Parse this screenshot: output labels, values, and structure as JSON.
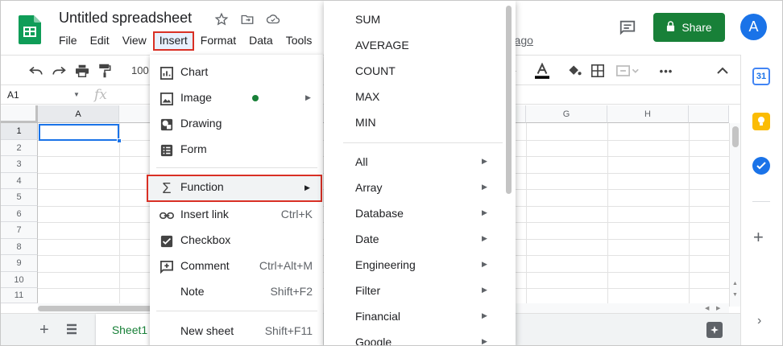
{
  "app": {
    "doc_title": "Untitled spreadsheet",
    "last_edit": "rs ago",
    "share_label": "Share",
    "avatar_initial": "A",
    "accent_green": "#188038"
  },
  "menubar": {
    "items": [
      "File",
      "Edit",
      "View",
      "Insert",
      "Format",
      "Data",
      "Tools",
      "A"
    ],
    "active": "Insert"
  },
  "toolbar": {
    "zoom": "100",
    "icons": [
      "undo-icon",
      "redo-icon",
      "print-icon",
      "paint-format-icon",
      "strikethrough-icon",
      "text-color-icon",
      "fill-color-icon",
      "borders-icon",
      "merge-cells-icon",
      "more-icon",
      "collapse-icon"
    ]
  },
  "formula_bar": {
    "name_box": "A1",
    "fx": "fx"
  },
  "grid": {
    "columns": [
      "A",
      "G",
      "H"
    ],
    "rows": [
      "1",
      "2",
      "3",
      "4",
      "5",
      "6",
      "7",
      "8",
      "9",
      "10",
      "11"
    ],
    "selected_cell": "A1"
  },
  "sheets": {
    "add_label": "+",
    "tabs": [
      "Sheet1"
    ]
  },
  "insert_menu": {
    "items": [
      {
        "label": "Chart",
        "icon": "chart-icon",
        "shortcut": ""
      },
      {
        "label": "Image",
        "icon": "image-icon",
        "shortcut": ""
      },
      {
        "label": "Drawing",
        "icon": "drawing-icon",
        "shortcut": ""
      },
      {
        "label": "Form",
        "icon": "form-icon",
        "shortcut": ""
      },
      {
        "label": "Function",
        "icon": "sigma-icon",
        "shortcut": ""
      },
      {
        "label": "Insert link",
        "icon": "link-icon",
        "shortcut": "Ctrl+K"
      },
      {
        "label": "Checkbox",
        "icon": "checkbox-icon",
        "shortcut": ""
      },
      {
        "label": "Comment",
        "icon": "comment-icon",
        "shortcut": "Ctrl+Alt+M"
      },
      {
        "label": "Note",
        "icon": "",
        "shortcut": "Shift+F2"
      },
      {
        "label": "New sheet",
        "icon": "",
        "shortcut": "Shift+F11"
      }
    ],
    "submenu_arrow": "▶"
  },
  "function_menu": {
    "common": [
      "SUM",
      "AVERAGE",
      "COUNT",
      "MAX",
      "MIN"
    ],
    "categories": [
      "All",
      "Array",
      "Database",
      "Date",
      "Engineering",
      "Filter",
      "Financial",
      "Google"
    ],
    "submenu_arrow": "▶"
  },
  "side_panel": {
    "icons": [
      "calendar-icon",
      "keep-icon",
      "tasks-icon",
      "add-addon-icon",
      "expand-icon"
    ],
    "calendar_day": "31"
  }
}
